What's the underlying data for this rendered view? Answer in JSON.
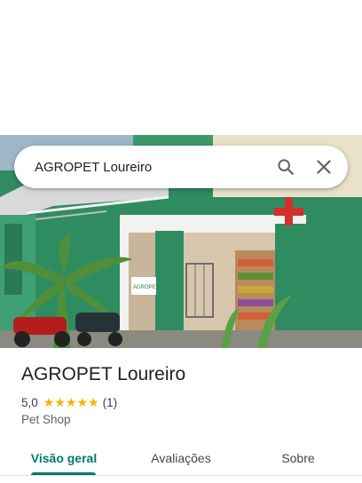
{
  "search": {
    "query": "AGROPET Loureiro",
    "search_icon": "search-icon",
    "close_icon": "close-icon"
  },
  "photo": {
    "signage_text": "AGROPET",
    "description_icon": "storefront-photo"
  },
  "place": {
    "name": "AGROPET Loureiro",
    "rating": "5,0",
    "stars": 5,
    "review_count": "(1)",
    "category": "Pet Shop"
  },
  "tabs": [
    {
      "label": "Visão geral",
      "active": true
    },
    {
      "label": "Avaliações",
      "active": false
    },
    {
      "label": "Sobre",
      "active": false
    }
  ],
  "colors": {
    "accent": "#00796b",
    "star": "#f6b400",
    "storefront_green": "#2e8a62",
    "cross_red": "#d32f2f"
  }
}
